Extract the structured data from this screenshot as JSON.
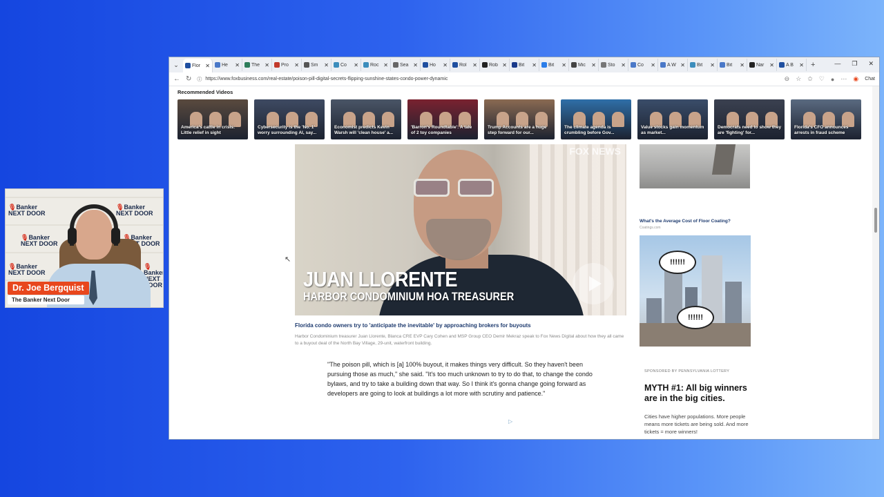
{
  "webcam": {
    "presenter_name": "Dr. Joe Bergquist",
    "show_name": "The Banker Next Door",
    "backdrop_logo_line1": "Banker",
    "backdrop_logo_line2": "NEXT DOOR"
  },
  "browser": {
    "tabs": [
      {
        "label": "Flor",
        "color": "#1f4fa0",
        "active": true
      },
      {
        "label": "He",
        "color": "#4a78c8"
      },
      {
        "label": "The",
        "color": "#2e7d5b"
      },
      {
        "label": "Pro",
        "color": "#c23a2b"
      },
      {
        "label": "Sm",
        "color": "#555555"
      },
      {
        "label": "Co",
        "color": "#3c8dbc"
      },
      {
        "label": "Roc",
        "color": "#3c8dbc"
      },
      {
        "label": "Sea",
        "color": "#666666"
      },
      {
        "label": "Ho",
        "color": "#1f4fa0"
      },
      {
        "label": "Rol",
        "color": "#1f4fa0"
      },
      {
        "label": "Rob",
        "color": "#222222"
      },
      {
        "label": "Bit",
        "color": "#1a3a8a"
      },
      {
        "label": "Bit",
        "color": "#2b7de9"
      },
      {
        "label": "Mic",
        "color": "#444444"
      },
      {
        "label": "Sto",
        "color": "#777777"
      },
      {
        "label": "Co",
        "color": "#4a78c8"
      },
      {
        "label": "A W",
        "color": "#4a78c8"
      },
      {
        "label": "Bit",
        "color": "#3c8dbc"
      },
      {
        "label": "Bit",
        "color": "#4a78c8"
      },
      {
        "label": "Nar",
        "color": "#222222"
      },
      {
        "label": "A B",
        "color": "#1f4fa0"
      }
    ],
    "tab_close_glyph": "✕",
    "new_tab_glyph": "+",
    "url": "https://www.foxbusiness.com/real-estate/poison-pill-digital-secrets-flipping-sunshine-states-condo-power-dynamic",
    "chat_label": "Chat"
  },
  "page": {
    "recommended_title": "Recommended Videos",
    "recommended_videos": [
      {
        "caption": "America's cattle in crisis: Little relief in sight",
        "bg": "#5a4a3e"
      },
      {
        "caption": "Cybersecurity is the 'No. 1' worry surrounding AI, say...",
        "bg": "#3e4a62"
      },
      {
        "caption": "Economist predicts Kevin Warsh will 'clean house' a...",
        "bg": "#4a5566"
      },
      {
        "caption": "'Barron's Roundtable': A tale of 2 toy companies",
        "bg": "#7a2230"
      },
      {
        "caption": "Trump Accounts are a huge step forward for our...",
        "bg": "#8a6a52"
      },
      {
        "caption": "The climate agenda is crumbling before Gov...",
        "bg": "#2f6fa8"
      },
      {
        "caption": "Value stocks gain momentum as market...",
        "bg": "#3a4d6a"
      },
      {
        "caption": "Democrats need to show they are 'fighting' for...",
        "bg": "#3b4150"
      },
      {
        "caption": "Florida's CFO announces arrests in fraud scheme",
        "bg": "#5a6a80"
      }
    ],
    "video": {
      "name": "JUAN LLORENTE",
      "role": "HARBOR CONDOMINIUM HOA TREASURER",
      "watermark": "FOX NEWS"
    },
    "headline": "Florida condo owners try to 'anticipate the inevitable' by approaching brokers for buyouts",
    "video_caption": "Harbor Condominium treasurer Juan Llorente, Blanca CRE EVP Cary Cohen and MSP Group CEO Demir Mekraz speak to Fox News Digital about how they all came to a buyout deal of the North Bay Village, 29-unit, waterfront building.",
    "quote": "\"The poison pill, which is [a] 100% buyout, it makes things very difficult. So they haven't been pursuing those as much,\" she said. \"It's too much unknown to try to do that, to change the condo bylaws, and try to take a building down that way. So I think it's gonna change going forward as developers are going to look at buildings a lot more with scrutiny and patience.\"",
    "ad1": {
      "title": "What's the Average Cost of Floor Coating?",
      "source": "Coatings.com"
    },
    "ad2": {
      "bubble_text": "!!!!!!"
    },
    "sponsored": {
      "label": "SPONSORED BY PENNSYLVANIA LOTTERY",
      "headline": "MYTH #1: All big winners are in the big cities.",
      "body": "Cities have higher populations. More people means more tickets are being sold. And more tickets = more winners!"
    }
  }
}
